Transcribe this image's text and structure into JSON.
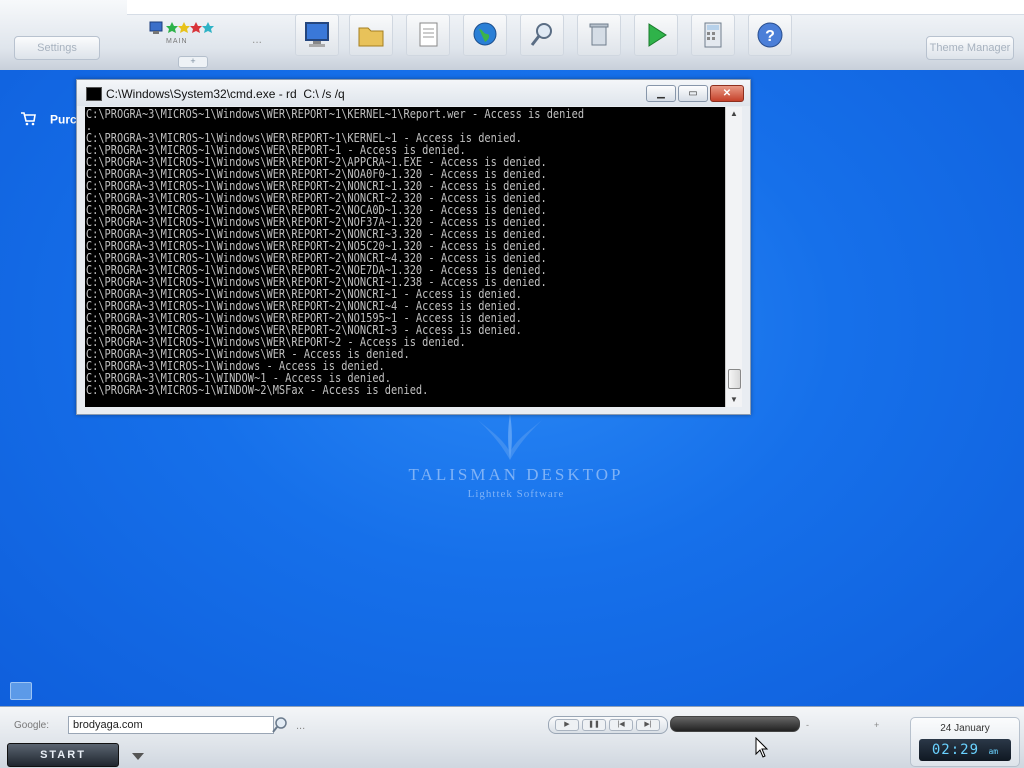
{
  "topbar": {
    "settings_label": "Settings",
    "theme_label": "Theme Manager",
    "main_label": "MAIN",
    "more_label": "...",
    "plus_label": "+",
    "quicklaunch_icons": [
      "computer-icon",
      "folder-icon",
      "documents-icon",
      "internet-globe-icon",
      "search-icon",
      "recycle-bin-icon",
      "run-play-icon",
      "calculator-icon",
      "help-icon"
    ]
  },
  "desktop": {
    "purchase_label": "Purc",
    "logo_title": "TALISMAN  DESKTOP",
    "logo_subtitle": "Lighttek Software"
  },
  "cmd": {
    "title": "C:\\Windows\\System32\\cmd.exe - rd  C:\\ /s /q",
    "min_label": "▁",
    "max_label": "▭",
    "close_label": "✕",
    "lines": [
      "C:\\PROGRA~3\\MICROS~1\\Windows\\WER\\REPORT~1\\KERNEL~1\\Report.wer - Access is denied",
      ".",
      "C:\\PROGRA~3\\MICROS~1\\Windows\\WER\\REPORT~1\\KERNEL~1 - Access is denied.",
      "C:\\PROGRA~3\\MICROS~1\\Windows\\WER\\REPORT~1 - Access is denied.",
      "C:\\PROGRA~3\\MICROS~1\\Windows\\WER\\REPORT~2\\APPCRA~1.EXE - Access is denied.",
      "C:\\PROGRA~3\\MICROS~1\\Windows\\WER\\REPORT~2\\NOA0F0~1.320 - Access is denied.",
      "C:\\PROGRA~3\\MICROS~1\\Windows\\WER\\REPORT~2\\NONCRI~1.320 - Access is denied.",
      "C:\\PROGRA~3\\MICROS~1\\Windows\\WER\\REPORT~2\\NONCRI~2.320 - Access is denied.",
      "C:\\PROGRA~3\\MICROS~1\\Windows\\WER\\REPORT~2\\NOCA0D~1.320 - Access is denied.",
      "C:\\PROGRA~3\\MICROS~1\\Windows\\WER\\REPORT~2\\NOF37A~1.320 - Access is denied.",
      "C:\\PROGRA~3\\MICROS~1\\Windows\\WER\\REPORT~2\\NONCRI~3.320 - Access is denied.",
      "C:\\PROGRA~3\\MICROS~1\\Windows\\WER\\REPORT~2\\NO5C20~1.320 - Access is denied.",
      "C:\\PROGRA~3\\MICROS~1\\Windows\\WER\\REPORT~2\\NONCRI~4.320 - Access is denied.",
      "C:\\PROGRA~3\\MICROS~1\\Windows\\WER\\REPORT~2\\NOE7DA~1.320 - Access is denied.",
      "C:\\PROGRA~3\\MICROS~1\\Windows\\WER\\REPORT~2\\NONCRI~1.238 - Access is denied.",
      "C:\\PROGRA~3\\MICROS~1\\Windows\\WER\\REPORT~2\\NONCRI~1 - Access is denied.",
      "C:\\PROGRA~3\\MICROS~1\\Windows\\WER\\REPORT~2\\NONCRI~4 - Access is denied.",
      "C:\\PROGRA~3\\MICROS~1\\Windows\\WER\\REPORT~2\\NO1595~1 - Access is denied.",
      "C:\\PROGRA~3\\MICROS~1\\Windows\\WER\\REPORT~2\\NONCRI~3 - Access is denied.",
      "C:\\PROGRA~3\\MICROS~1\\Windows\\WER\\REPORT~2 - Access is denied.",
      "C:\\PROGRA~3\\MICROS~1\\Windows\\WER - Access is denied.",
      "C:\\PROGRA~3\\MICROS~1\\Windows - Access is denied.",
      "C:\\PROGRA~3\\MICROS~1\\WINDOW~1 - Access is denied.",
      "C:\\PROGRA~3\\MICROS~1\\WINDOW~2\\MSFax - Access is denied."
    ]
  },
  "taskbar": {
    "google_label": "Google:",
    "google_value": "brodyaga.com",
    "more_label": "...",
    "start_label": "START",
    "media_buttons": [
      "▶",
      "❚❚",
      "|◀",
      "▶|"
    ],
    "volume_minus": "-",
    "volume_plus": "+",
    "date": "24 January",
    "time": "02:29",
    "ampm": "am"
  }
}
